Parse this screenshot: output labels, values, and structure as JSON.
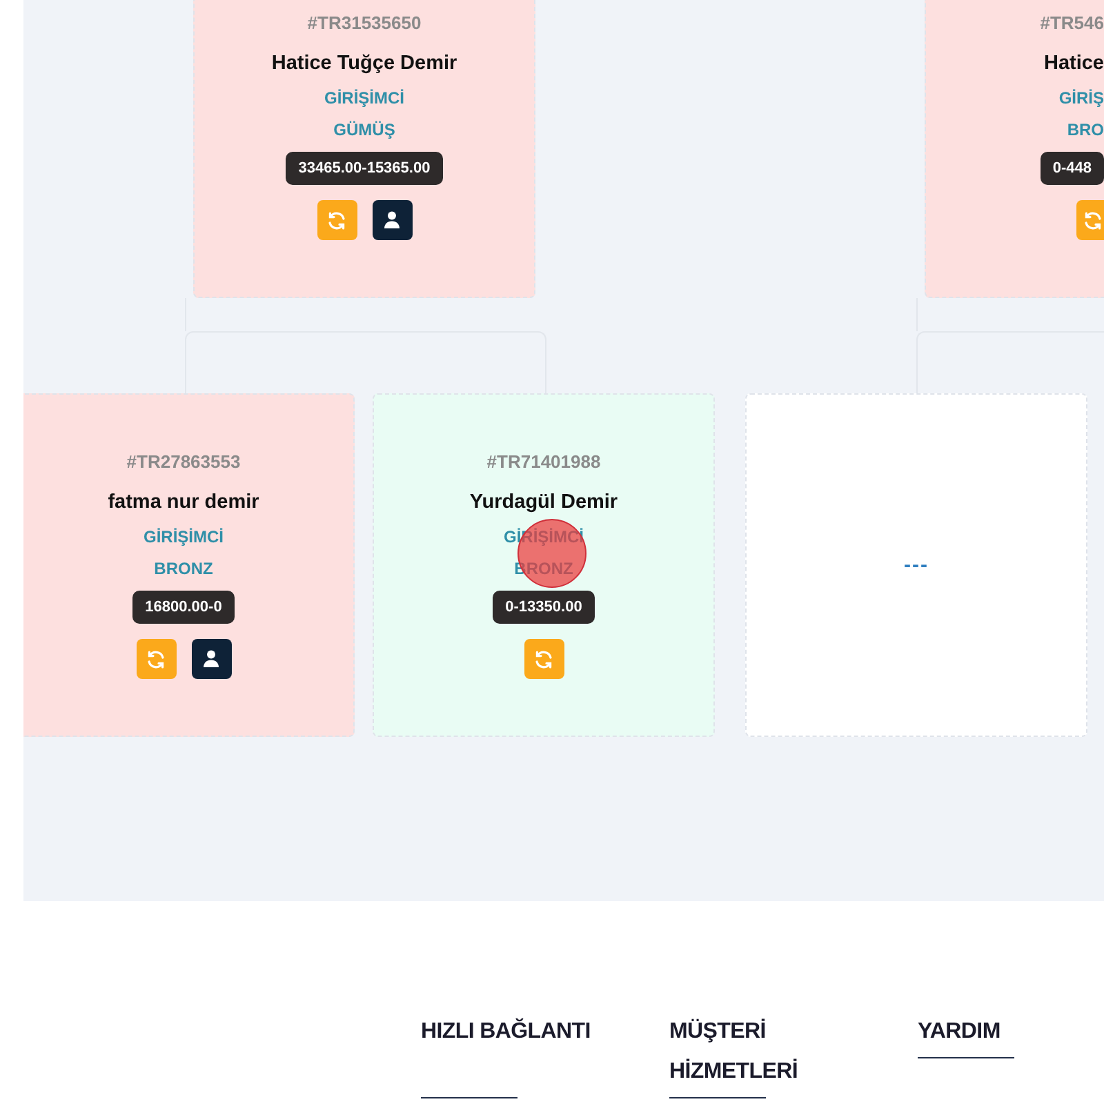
{
  "tree": {
    "rows": [
      {
        "nodes": [
          {
            "kind": "member",
            "color": "#fde0df",
            "id": "#TR31535650",
            "name": "Hatice Tuğçe Demir",
            "role": "GİRİŞİMCİ",
            "rank": "GÜMÜŞ",
            "balance": "33465.00-15365.00",
            "actions": [
              {
                "kind": "refresh"
              },
              {
                "kind": "profile"
              }
            ]
          },
          {
            "kind": "member",
            "color": "#fde0df",
            "id": "#TR546",
            "name": "Hatice",
            "role": "GİRİŞ",
            "rank": "BRO",
            "balance": "0-448",
            "actions": [
              {
                "kind": "refresh"
              }
            ]
          }
        ]
      },
      {
        "nodes": [
          {
            "kind": "member",
            "color": "#fde0df",
            "id": "#TR27863553",
            "name": "fatma nur demir",
            "role": "GİRİŞİMCİ",
            "rank": "BRONZ",
            "balance": "16800.00-0",
            "actions": [
              {
                "kind": "refresh"
              },
              {
                "kind": "profile"
              }
            ]
          },
          {
            "kind": "member",
            "color": "#e9fcf4",
            "id": "#TR71401988",
            "name": "Yurdagül Demir",
            "role": "GİRİŞİMCİ",
            "rank": "BRONZ",
            "balance": "0-13350.00",
            "actions": [
              {
                "kind": "refresh"
              }
            ]
          },
          {
            "kind": "empty",
            "color": "#ffffff",
            "text": "---"
          }
        ]
      }
    ]
  },
  "touch_marker": true,
  "footer": {
    "columns": [
      {
        "title": "HIZLI BAĞLANTI"
      },
      {
        "title": "MÜŞTERİ HİZMETLERİ"
      },
      {
        "title": "YARDIM"
      }
    ]
  }
}
